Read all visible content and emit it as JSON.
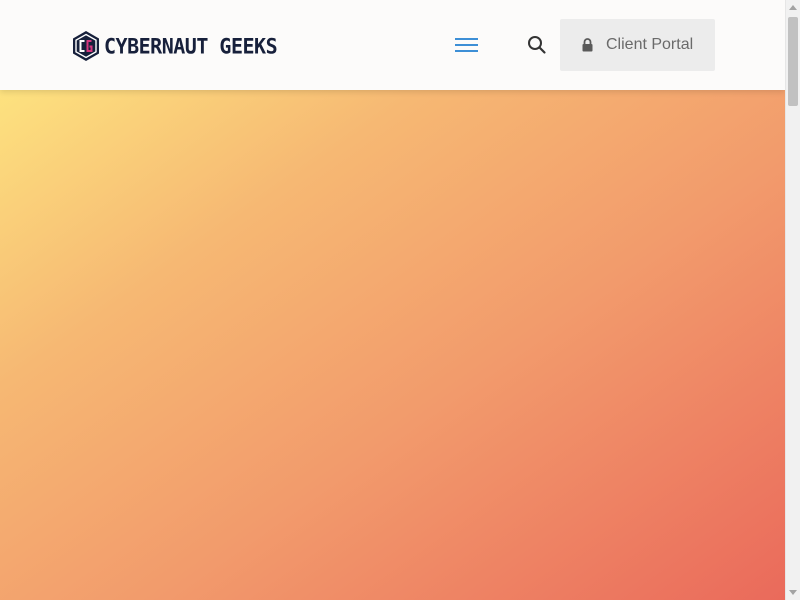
{
  "header": {
    "logo": {
      "text": "CYBERNAUT GEEKS",
      "icon": "cg-hexagon-logo-icon"
    },
    "menu_icon": "hamburger-menu-icon",
    "search_icon": "search-icon",
    "client_portal": {
      "label": "Client Portal",
      "icon": "lock-icon"
    }
  },
  "hero": {
    "gradient_colors": [
      "#fde27f",
      "#f6b873",
      "#f29b6c",
      "#ea6a5b"
    ]
  },
  "colors": {
    "menu_accent": "#3d8fd6",
    "logo_dark": "#17203b",
    "logo_accent": "#d6377f",
    "portal_background": "#ececec",
    "portal_text": "#6a6a6a"
  }
}
